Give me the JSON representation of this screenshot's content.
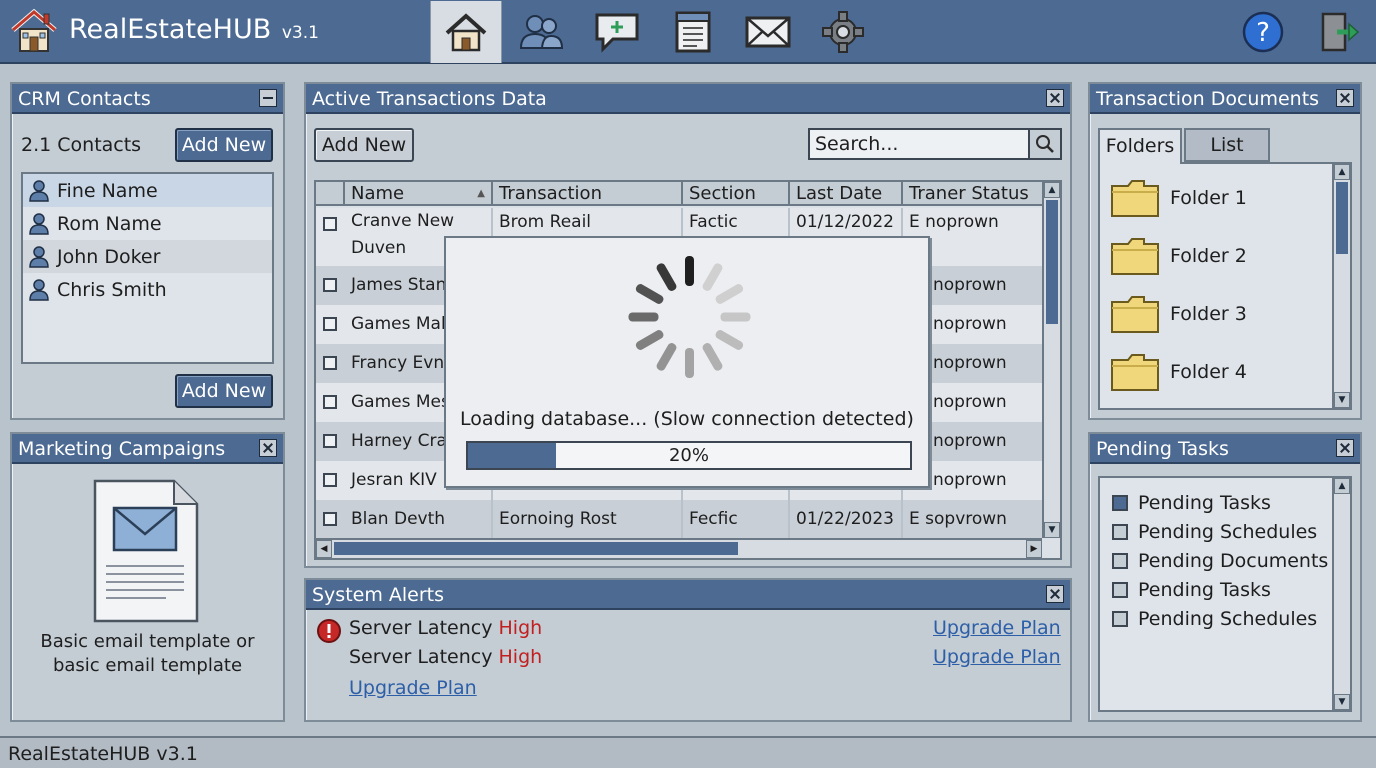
{
  "app": {
    "name": "RealEstateHUB",
    "version": "v3.1"
  },
  "nav": {
    "icons": [
      "home-icon",
      "people-icon",
      "chat-icon",
      "document-icon",
      "mail-icon",
      "gear-icon"
    ],
    "active": "home-icon",
    "right_icons": [
      "help-icon",
      "logout-icon"
    ]
  },
  "crm": {
    "title": "CRM Contacts",
    "count_label": "2.1 Contacts",
    "add_new": "Add New",
    "add_new_bottom": "Add New",
    "contacts": [
      {
        "name": "Fine Name",
        "selected": true
      },
      {
        "name": "Rom Name",
        "selected": false
      },
      {
        "name": "John Doker",
        "selected": false
      },
      {
        "name": "Chris Smith",
        "selected": false
      }
    ]
  },
  "marketing": {
    "title": "Marketing Campaigns",
    "caption_line1": "Basic email template or",
    "caption_line2": "basic email template"
  },
  "transactions": {
    "title": "Active Transactions Data",
    "add_new": "Add New",
    "search_placeholder": "Search...",
    "columns": [
      "Name",
      "Transaction",
      "Section",
      "Last Date",
      "Traner Status"
    ],
    "rows": [
      {
        "name": "Cranve New",
        "name2": "Duven",
        "transaction": "Brom Reail",
        "section": "Factic",
        "date": "01/12/2022",
        "status": "E noprown"
      },
      {
        "name": "James Stan",
        "transaction": "",
        "section": "",
        "date": "",
        "status": "noprown"
      },
      {
        "name": "Games Mah",
        "transaction": "",
        "section": "",
        "date": "",
        "status": "noprown"
      },
      {
        "name": "Francy Evns",
        "transaction": "",
        "section": "",
        "date": "",
        "status": "noprown"
      },
      {
        "name": "Games Mesr",
        "transaction": "",
        "section": "",
        "date": "",
        "status": "noprown"
      },
      {
        "name": "Harney Cran",
        "transaction": "",
        "section": "",
        "date": "",
        "status": "noprown"
      },
      {
        "name": "Jesran KIV",
        "transaction": "",
        "section": "",
        "date": "",
        "status": "noprown"
      },
      {
        "name": "Blan Devth",
        "transaction": "Eornoing Rost",
        "section": "Fecfic",
        "date": "01/22/2023",
        "status": "E sopvrown"
      }
    ]
  },
  "loading": {
    "message": "Loading database... (Slow connection detected)",
    "progress_fraction": 0.2,
    "progress_label": "20%"
  },
  "alerts": {
    "title": "System Alerts",
    "items": [
      {
        "label": "Server Latency",
        "level": "High"
      },
      {
        "label": "Server Latency",
        "level": "High"
      }
    ],
    "upgrade_links": [
      "Upgrade Plan",
      "Upgrade Plan",
      "Upgrade Plan"
    ]
  },
  "documents": {
    "title": "Transaction Documents",
    "tabs": [
      "Folders",
      "List"
    ],
    "active_tab": "Folders",
    "folders": [
      "Folder 1",
      "Folder 2",
      "Folder 3",
      "Folder 4"
    ]
  },
  "tasks": {
    "title": "Pending Tasks",
    "items": [
      {
        "label": "Pending Tasks",
        "checked": true
      },
      {
        "label": "Pending Schedules",
        "checked": false
      },
      {
        "label": "Pending Documents",
        "checked": false
      },
      {
        "label": "Pending Tasks",
        "checked": false
      },
      {
        "label": "Pending Schedules",
        "checked": false
      }
    ]
  },
  "status_bar": {
    "text": "RealEstateHUB v3.1"
  },
  "colors": {
    "accent": "#4c6a92",
    "background": "#b9c3cc",
    "alert_red": "#c21f1f",
    "link": "#2d5fa8",
    "folder": "#f0d77c"
  }
}
